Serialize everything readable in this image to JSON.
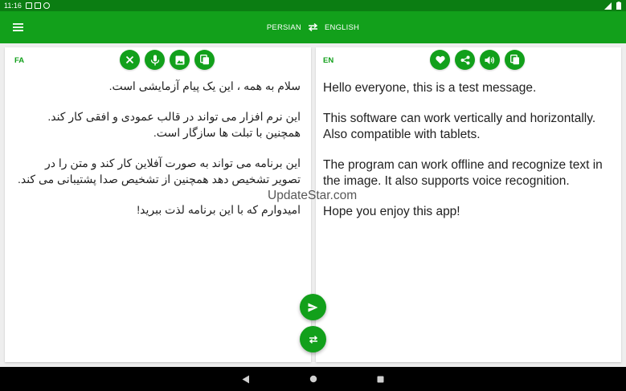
{
  "status_bar": {
    "time": "11:16"
  },
  "app_bar": {
    "source_language": "PERSIAN",
    "target_language": "ENGLISH"
  },
  "source_panel": {
    "tag": "FA",
    "paragraphs": [
      "سلام به همه ، این یک پیام آزمایشی است.",
      "این نرم افزار می تواند در قالب عمودی و افقی کار کند. همچنین با تبلت ها سازگار است.",
      "این برنامه می تواند به صورت آفلاین کار کند و متن را در تصویر تشخیص دهد همچنین از تشخیص صدا پشتیبانی می کند.",
      "امیدوارم که با این برنامه لذت ببرید!"
    ]
  },
  "target_panel": {
    "tag": "EN",
    "paragraphs": [
      "Hello everyone, this is a test message.",
      "This software can work vertically and horizontally. Also compatible with tablets.",
      "The program can work offline and recognize text in the image. It also supports voice recognition.",
      "Hope you enjoy this app!"
    ]
  },
  "watermark": "UpdateStar.com",
  "colors": {
    "accent": "#12a01b",
    "status_bar": "#0b7d12"
  }
}
